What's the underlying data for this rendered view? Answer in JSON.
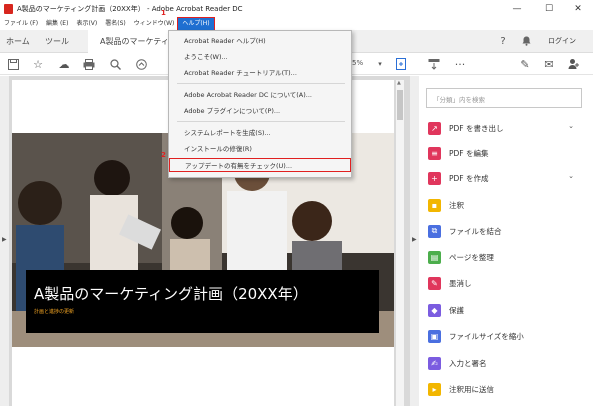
{
  "window": {
    "title": "A製品のマーケティング計画（20XX年） - Adobe Acrobat Reader DC",
    "controls": [
      "—",
      "☐",
      "✕"
    ]
  },
  "menubar": {
    "items": [
      "ファイル (F)",
      "編集 (E)",
      "表示(V)",
      "署名(S)",
      "ウィンドウ(W)",
      "ヘルプ(H)"
    ]
  },
  "tabs": {
    "home": "ホーム",
    "tools": "ツール",
    "document": "A製品のマーケティング...",
    "login": "ログイン"
  },
  "toolbar": {
    "zoom": "5%"
  },
  "help_menu": {
    "items": [
      "Acrobat Reader ヘルプ(H)",
      "ようこそ(W)...",
      "Acrobat Reader チュートリアル(T)...",
      "Adobe Acrobat Reader DC について(A)...",
      "Adobe プラグインについて(P)...",
      "システムレポートを生成(S)...",
      "インストールの修復(R)",
      "アップデートの有無をチェック(U)..."
    ]
  },
  "callouts": {
    "step1": "1",
    "step2": "2"
  },
  "document": {
    "banner_title": "A製品のマーケティング計画（20XX年）",
    "banner_subtitle": "計画と進捗の更新"
  },
  "right_pane": {
    "search_placeholder": "「分類」内を検索",
    "tools": [
      {
        "label": "PDF を書き出し",
        "icon": "export-pdf-icon",
        "color": "#e0365c",
        "chevron": true
      },
      {
        "label": "PDF を編集",
        "icon": "edit-pdf-icon",
        "color": "#e0365c",
        "chevron": false
      },
      {
        "label": "PDF を作成",
        "icon": "create-pdf-icon",
        "color": "#e0365c",
        "chevron": true
      },
      {
        "label": "注釈",
        "icon": "comment-icon",
        "color": "#f2b600",
        "chevron": false
      },
      {
        "label": "ファイルを結合",
        "icon": "combine-files-icon",
        "color": "#4a6fe0",
        "chevron": false
      },
      {
        "label": "ページを整理",
        "icon": "organize-pages-icon",
        "color": "#4cae4c",
        "chevron": false
      },
      {
        "label": "墨消し",
        "icon": "redact-icon",
        "color": "#e0365c",
        "chevron": false
      },
      {
        "label": "保護",
        "icon": "protect-icon",
        "color": "#7b5ce0",
        "chevron": false
      },
      {
        "label": "ファイルサイズを縮小",
        "icon": "compress-icon",
        "color": "#4a6fe0",
        "chevron": false
      },
      {
        "label": "入力と署名",
        "icon": "fill-sign-icon",
        "color": "#7b5ce0",
        "chevron": false
      },
      {
        "label": "注釈用に送信",
        "icon": "send-comments-icon",
        "color": "#f2b600",
        "chevron": false
      }
    ]
  },
  "colors": {
    "accent": "#1f6fd1",
    "callout": "#e02020"
  }
}
